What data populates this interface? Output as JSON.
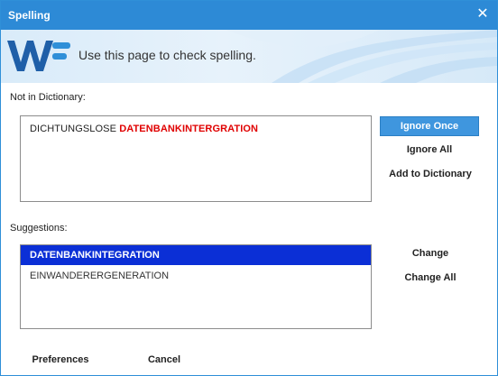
{
  "window": {
    "title": "Spelling",
    "close_symbol": "✕"
  },
  "banner": {
    "logo_icon": "wf-logo-icon",
    "text": "Use this page to check spelling."
  },
  "not_in_dictionary": {
    "label": "Not in Dictionary:",
    "word_normal": "DICHTUNGSLOSE",
    "word_error": "DATENBANKINTERGRATION"
  },
  "actions": {
    "ignore_once": "Ignore Once",
    "ignore_all": "Ignore All",
    "add_to_dictionary": "Add to Dictionary",
    "change": "Change",
    "change_all": "Change All"
  },
  "suggestions": {
    "label": "Suggestions:",
    "items": [
      "DATENBANKINTEGRATION",
      "EINWANDERERGENERATION"
    ],
    "selected_index": 0
  },
  "footer": {
    "preferences": "Preferences",
    "cancel": "Cancel"
  },
  "colors": {
    "titlebar": "#2d8ad6",
    "error_text": "#e00000",
    "selection": "#0b2fd6",
    "primary_button": "#3f96de"
  }
}
